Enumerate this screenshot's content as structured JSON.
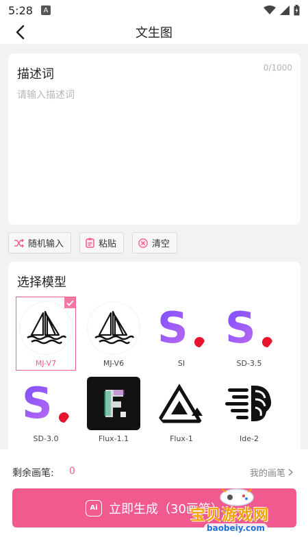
{
  "status_bar": {
    "time": "5:28",
    "notif_letter": "A"
  },
  "header": {
    "title": "文生图"
  },
  "description": {
    "title": "描述词",
    "counter": "0/1000",
    "placeholder": "请输入描述词",
    "value": ""
  },
  "actions": {
    "random_label": "随机输入",
    "paste_label": "粘贴",
    "clear_label": "清空"
  },
  "models": {
    "title": "选择模型",
    "items": [
      {
        "label": "MJ-V7",
        "icon": "sailboat-logo",
        "selected": true
      },
      {
        "label": "MJ-V6",
        "icon": "sailboat-logo",
        "selected": false
      },
      {
        "label": "SI",
        "icon": "s-dot-logo",
        "selected": false
      },
      {
        "label": "SD-3.5",
        "icon": "s-dot-logo",
        "selected": false
      },
      {
        "label": "SD-3.0",
        "icon": "s-dot-logo",
        "selected": false
      },
      {
        "label": "Flux-1.1",
        "icon": "flux-f-logo",
        "selected": false
      },
      {
        "label": "Flux-1",
        "icon": "triangle-logo",
        "selected": false
      },
      {
        "label": "Ide-2",
        "icon": "brain-logo",
        "selected": false
      }
    ]
  },
  "bottom": {
    "remain_label": "剩余画笔:",
    "remain_value": "0",
    "my_brush_label": "我的画笔",
    "generate_label": "立即生成（30画笔）",
    "ai_badge": "Ai"
  },
  "watermark": {
    "text": "宝贝游戏网",
    "url": "baobeiy.com"
  },
  "colors": {
    "accent": "#f05a8f",
    "selected_border": "#ee5d8f",
    "dot_red": "#e6142d"
  }
}
